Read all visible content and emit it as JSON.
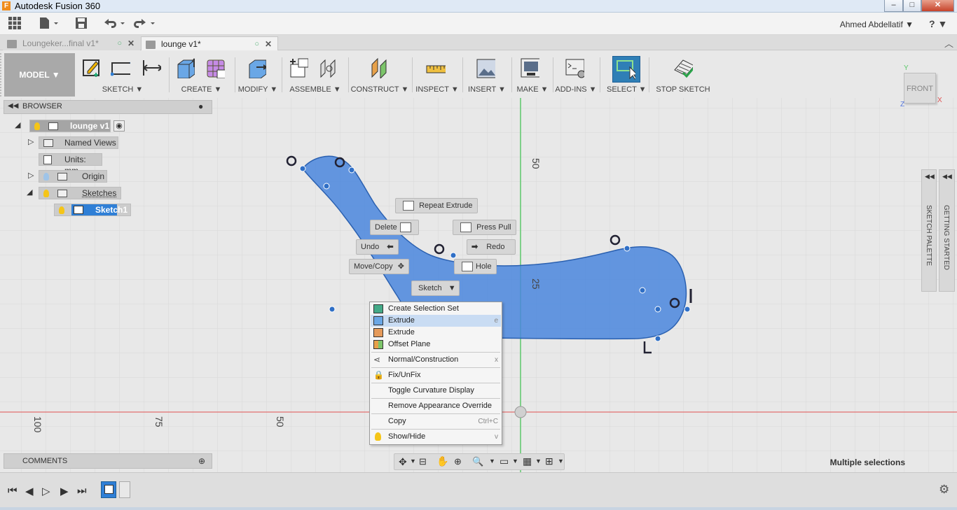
{
  "window": {
    "title": "Autodesk Fusion 360",
    "min": "–",
    "max": "□",
    "close": "✕"
  },
  "menubar": {
    "user": "Ahmed Abdellatif ▼",
    "help": "? ▼"
  },
  "tabs": [
    {
      "label": "Loungeker...final v1*"
    },
    {
      "label": "lounge v1*"
    }
  ],
  "toolbar": {
    "workspace": "MODEL ▼",
    "groups": [
      "SKETCH ▼",
      "CREATE ▼",
      "MODIFY ▼",
      "ASSEMBLE ▼",
      "CONSTRUCT ▼",
      "INSPECT ▼",
      "INSERT ▼",
      "MAKE ▼",
      "ADD-INS ▼",
      "SELECT ▼",
      "STOP SKETCH"
    ]
  },
  "browser": {
    "header": "BROWSER",
    "root": "lounge v1",
    "items": [
      "Named Views",
      "Units: mm",
      "Origin",
      "Sketches",
      "Sketch1"
    ]
  },
  "comments": {
    "header": "COMMENTS"
  },
  "viewcube": {
    "face": "FRONT",
    "x": "X",
    "y": "Y",
    "z": "Z"
  },
  "palettes": {
    "sketch": "SKETCH PALETTE",
    "getting_started": "GETTING STARTED"
  },
  "axis_labels": {
    "top50": "50",
    "mid25": "25",
    "b100": "100",
    "b75": "75",
    "b50": "50"
  },
  "marking_menu": {
    "repeat": "Repeat Extrude",
    "delete": "Delete",
    "press_pull": "Press Pull",
    "undo": "Undo",
    "redo": "Redo",
    "move": "Move/Copy",
    "hole": "Hole",
    "sketch": "Sketch"
  },
  "context_menu": [
    {
      "label": "Create Selection Set",
      "shortcut": ""
    },
    {
      "label": "Extrude",
      "shortcut": "e"
    },
    {
      "label": "Extrude",
      "shortcut": ""
    },
    {
      "label": "Offset Plane",
      "shortcut": ""
    },
    {
      "label": "Normal/Construction",
      "shortcut": "x"
    },
    {
      "label": "Fix/UnFix",
      "shortcut": ""
    },
    {
      "label": "Toggle Curvature Display",
      "shortcut": ""
    },
    {
      "label": "Remove Appearance Override",
      "shortcut": ""
    },
    {
      "label": "Copy",
      "shortcut": "Ctrl+C"
    },
    {
      "label": "Show/Hide",
      "shortcut": "v"
    }
  ],
  "status": "Multiple selections",
  "colors": {
    "accent": "#2f7fd6",
    "shape": "#4a86dd",
    "axis_red": "#e05050",
    "axis_green": "#5cc86a"
  }
}
